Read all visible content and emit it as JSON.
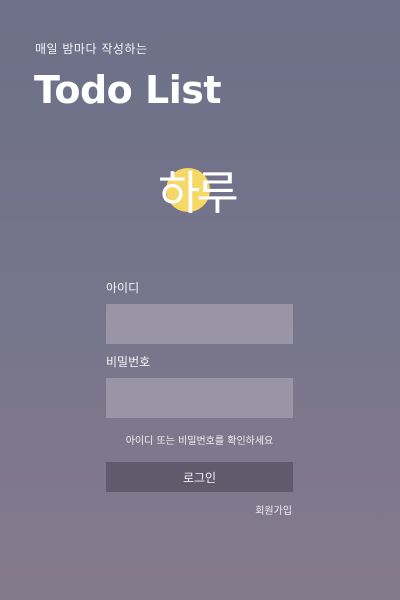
{
  "header": {
    "subtitle": "매일 밤마다 작성하는",
    "title": "Todo List"
  },
  "logo": {
    "text": "하루",
    "moon_color": "#f6d866"
  },
  "form": {
    "id_label": "아이디",
    "id_value": "",
    "password_label": "비밀번호",
    "password_value": "",
    "error_message": "아이디 또는 비밀번호를 확인하세요",
    "login_label": "로그인",
    "signup_label": "회원가입"
  },
  "colors": {
    "background_top": "#6c7088",
    "background_bottom": "#857a8c",
    "field_bg": "#9995a7",
    "button_bg": "#5f5a6c"
  }
}
